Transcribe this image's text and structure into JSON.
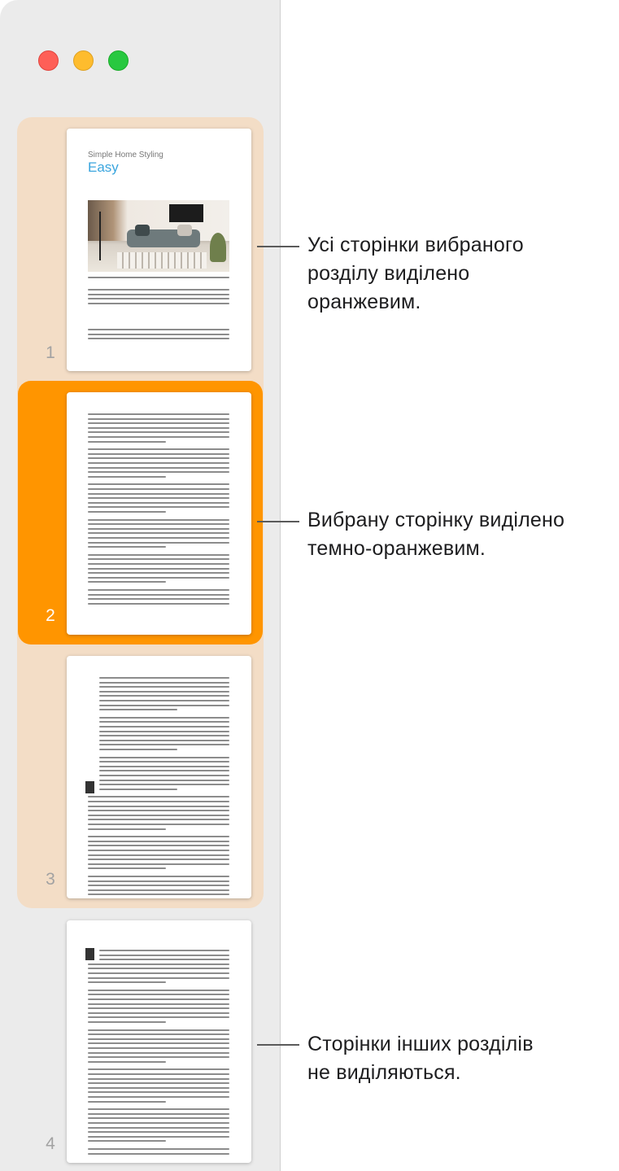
{
  "window": {
    "buttons": [
      "close",
      "minimize",
      "zoom"
    ]
  },
  "pages": [
    {
      "number": "1",
      "state": "in-selected-section"
    },
    {
      "number": "2",
      "state": "selected"
    },
    {
      "number": "3",
      "state": "in-selected-section"
    },
    {
      "number": "4",
      "state": "other-section"
    }
  ],
  "page1": {
    "subtitle": "Simple Home Styling",
    "title": "Easy"
  },
  "callouts": {
    "section": [
      "Усі сторінки вибраного",
      "розділу виділено",
      "оранжевим."
    ],
    "selected": [
      "Вибрану сторінку виділено",
      "темно-оранжевим."
    ],
    "other": [
      "Сторінки інших розділів",
      "не виділяються."
    ]
  },
  "colors": {
    "section_highlight": "#f3ddc6",
    "selected_highlight": "#ff9500",
    "sidebar": "#ebebeb",
    "title_accent": "#3aa5de"
  }
}
